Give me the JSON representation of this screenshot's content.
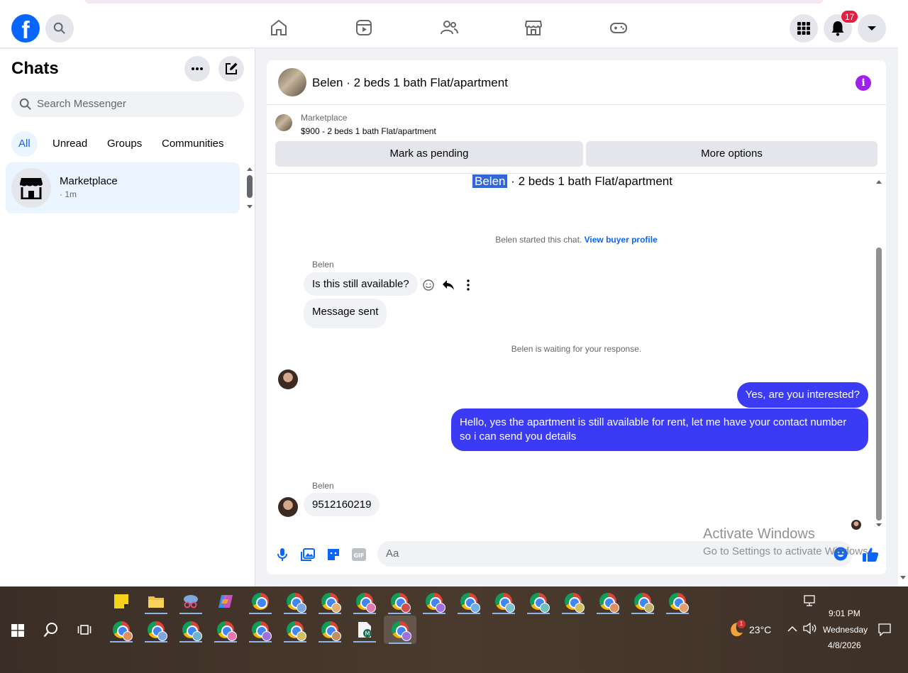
{
  "header": {
    "logo_letter": "f",
    "notification_count": "17"
  },
  "sidebar": {
    "title": "Chats",
    "search_placeholder": "Search Messenger",
    "filters": [
      "All",
      "Unread",
      "Groups",
      "Communities"
    ],
    "chat": {
      "name": "Marketplace",
      "time": "· 1m"
    }
  },
  "conversation": {
    "title": "Belen · 2 beds 1 bath Flat/apartment",
    "marketplace_label": "Marketplace",
    "listing": "$900 - 2 beds 1 bath Flat/apartment",
    "mark_pending": "Mark as pending",
    "more_options": "More options",
    "thread_title_highlight": "Belen",
    "thread_title_rest": " · 2 beds 1 bath Flat/apartment",
    "started_text": "Belen started this chat.",
    "view_profile": "View buyer profile",
    "sender_name": "Belen",
    "msg1": "Is this still available?",
    "msg2": "Message sent",
    "waiting": "Belen is waiting for your response.",
    "out1": "Yes, are you interested?",
    "out2": "Hello, yes the apartment is still available for rent, let me have your contact number so i can send you details",
    "msg3": "9512160219",
    "composer_placeholder": "Aa"
  },
  "watermark": {
    "line1": "Activate Windows",
    "line2": "Go to Settings to activate Windows."
  },
  "taskbar": {
    "weather": "23°C",
    "weather_badge": "1",
    "time": "9:01 PM",
    "day": "Wednesday",
    "date": "4/8/2026"
  },
  "colors": {
    "brand": "#0866ff",
    "outgoing_bubble": "#3b3bf5",
    "badge": "#e41e3f"
  }
}
